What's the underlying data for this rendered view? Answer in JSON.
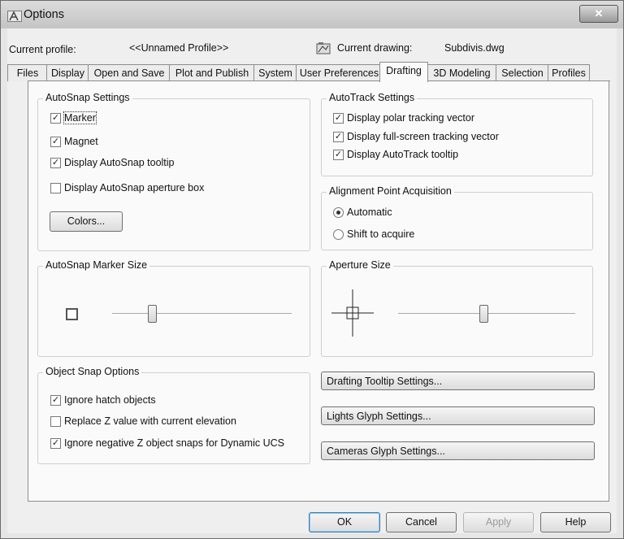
{
  "window": {
    "title": "Options",
    "close_label": "✕"
  },
  "profile": {
    "label": "Current profile:",
    "value": "<<Unnamed Profile>>"
  },
  "drawing": {
    "label": "Current drawing:",
    "value": "Subdivis.dwg"
  },
  "tabs": [
    {
      "label": "Files"
    },
    {
      "label": "Display"
    },
    {
      "label": "Open and Save"
    },
    {
      "label": "Plot and Publish"
    },
    {
      "label": "System"
    },
    {
      "label": "User Preferences"
    },
    {
      "label": "Drafting",
      "active": true
    },
    {
      "label": "3D Modeling"
    },
    {
      "label": "Selection"
    },
    {
      "label": "Profiles"
    }
  ],
  "autosnap": {
    "title": "AutoSnap Settings",
    "marker": {
      "label": "Marker",
      "checked": true
    },
    "magnet": {
      "label": "Magnet",
      "checked": true
    },
    "tooltip": {
      "label": "Display AutoSnap tooltip",
      "checked": true
    },
    "aperture_box": {
      "label": "Display AutoSnap aperture box",
      "checked": false
    },
    "colors_button": "Colors..."
  },
  "autotrack": {
    "title": "AutoTrack Settings",
    "polar": {
      "label": "Display polar tracking vector",
      "checked": true
    },
    "fullscreen": {
      "label": "Display full-screen tracking vector",
      "checked": true
    },
    "tooltip": {
      "label": "Display AutoTrack tooltip",
      "checked": true
    }
  },
  "alignment": {
    "title": "Alignment Point Acquisition",
    "automatic": {
      "label": "Automatic",
      "selected": true
    },
    "shift": {
      "label": "Shift to acquire",
      "selected": false
    }
  },
  "marker_size": {
    "title": "AutoSnap Marker Size",
    "level": 0.22
  },
  "aperture_size": {
    "title": "Aperture Size",
    "level": 0.48
  },
  "object_snap": {
    "title": "Object Snap Options",
    "ignore_hatch": {
      "label": "Ignore hatch objects",
      "checked": true
    },
    "replace_z": {
      "label": "Replace Z value with current elevation",
      "checked": false
    },
    "ignore_negative_z": {
      "label": "Ignore negative Z object snaps for Dynamic UCS",
      "checked": true
    }
  },
  "settings_buttons": {
    "drafting_tooltip": "Drafting Tooltip Settings...",
    "lights_glyph": "Lights Glyph Settings...",
    "cameras_glyph": "Cameras Glyph Settings..."
  },
  "footer": {
    "ok": "OK",
    "cancel": "Cancel",
    "apply": "Apply",
    "help": "Help"
  },
  "check_glyph": "✓"
}
